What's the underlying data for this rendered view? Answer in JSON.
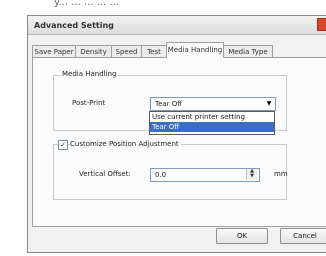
{
  "top_text": "y... ... ... ... ...",
  "window": {
    "title": "Advanced Setting",
    "tabs": [
      {
        "label": "Save Paper"
      },
      {
        "label": "Density"
      },
      {
        "label": "Speed"
      },
      {
        "label": "Test"
      },
      {
        "label": "Media Handling"
      },
      {
        "label": "Media Type"
      }
    ],
    "active_tab": "Media Handling"
  },
  "media_handling_group": {
    "title": "Media Handling",
    "post_print_label": "Post-Print",
    "post_print_value": "Tear Off",
    "options": [
      "Use current printer setting",
      "Tear Off"
    ]
  },
  "customize_group": {
    "checkbox_label": "Customize Position Adjustment",
    "checked": true,
    "vertical_offset_label": "Vertical Offset:",
    "vertical_offset_value": "0.0",
    "unit": "mm"
  },
  "buttons": {
    "ok": "OK",
    "cancel": "Cancel"
  }
}
